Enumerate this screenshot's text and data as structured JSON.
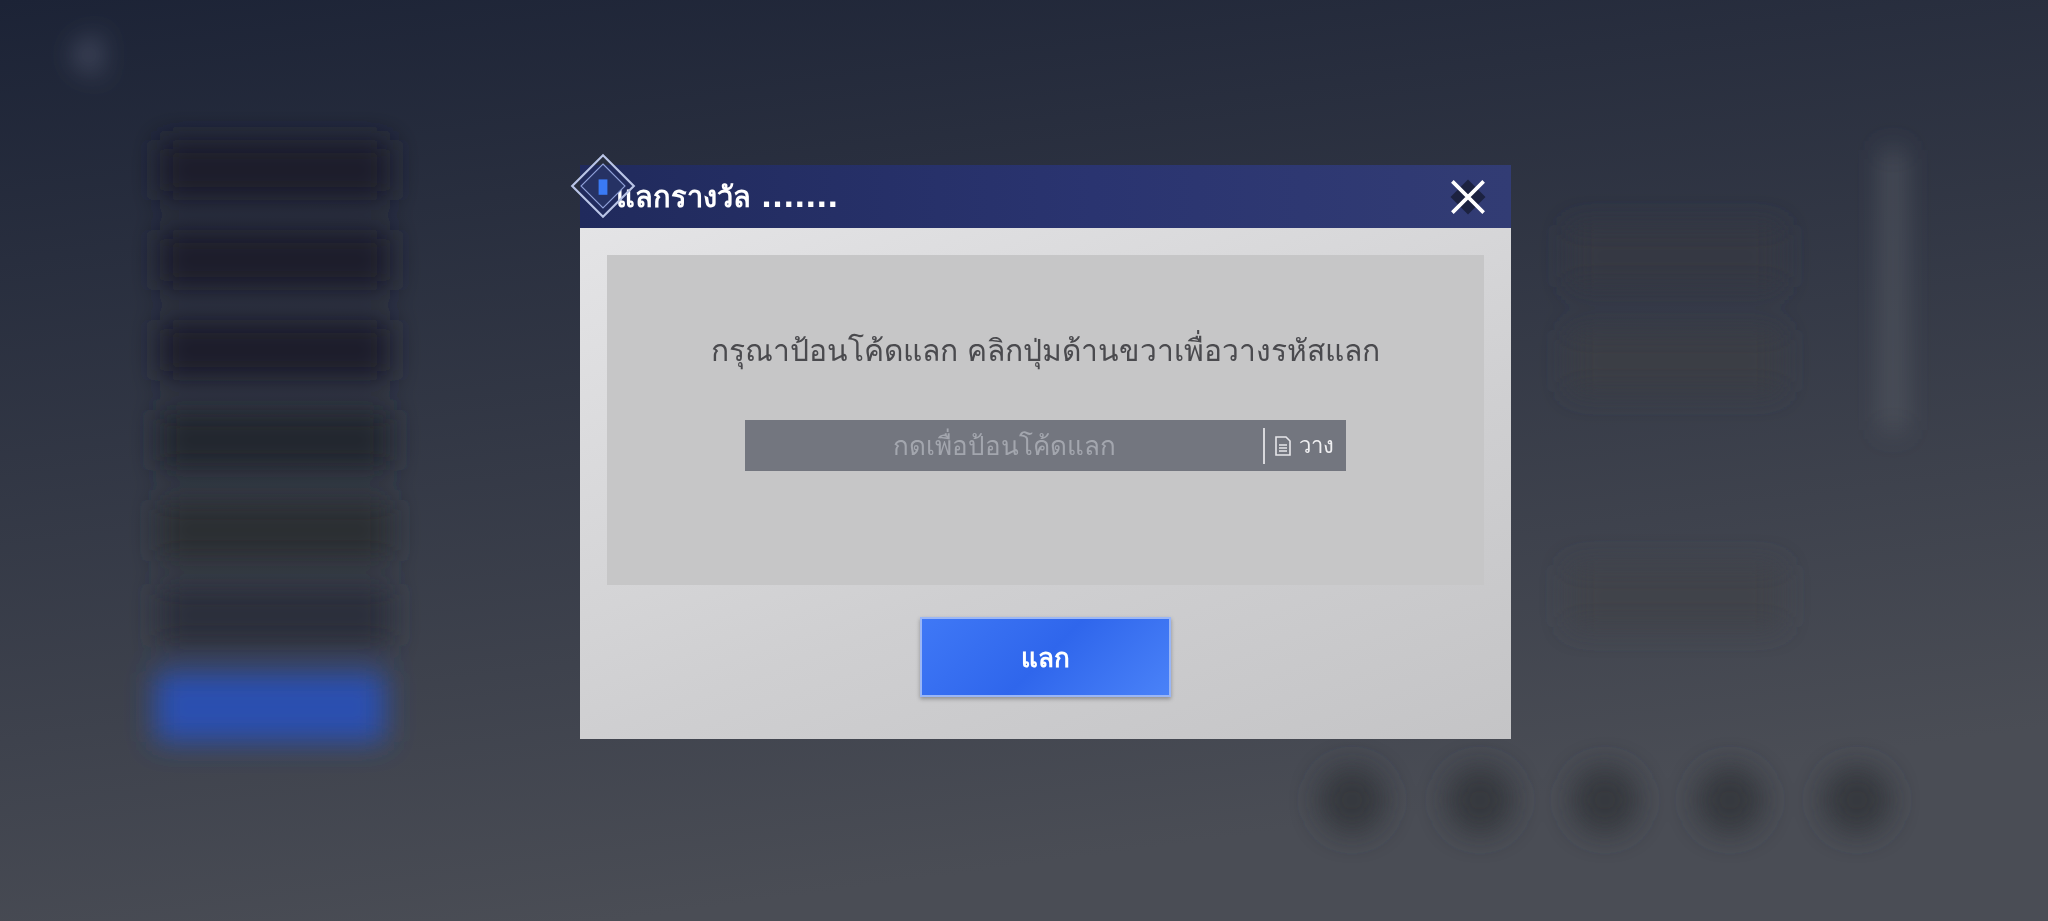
{
  "dialog": {
    "title": "แลกรางวัล .......",
    "instruction": "กรุณาป้อนโค้ดแลก คลิกปุ่มด้านขวาเพื่อวางรหัสแลก",
    "code_field": {
      "placeholder": "กดเพื่อป้อนโค้ดแลก"
    },
    "paste_button": "วาง",
    "submit_button": "แลก"
  }
}
